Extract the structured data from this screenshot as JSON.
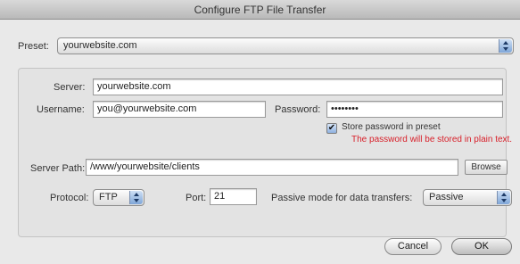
{
  "window": {
    "title": "Configure FTP File Transfer"
  },
  "preset": {
    "label": "Preset:",
    "value": "yourwebsite.com"
  },
  "server": {
    "label": "Server:",
    "value": "yourwebsite.com"
  },
  "username": {
    "label": "Username:",
    "value": "you@yourwebsite.com"
  },
  "password": {
    "label": "Password:",
    "value": "••••••••",
    "store_label": "Store password in preset",
    "store_checked": true,
    "warning": "The password will be stored in plain text."
  },
  "server_path": {
    "label": "Server Path:",
    "value": "/www/yourwebsite/clients",
    "browse_label": "Browse"
  },
  "protocol": {
    "label": "Protocol:",
    "value": "FTP"
  },
  "port": {
    "label": "Port:",
    "value": "21"
  },
  "passive": {
    "label": "Passive mode for data transfers:",
    "value": "Passive"
  },
  "buttons": {
    "cancel": "Cancel",
    "ok": "OK"
  },
  "icons": {
    "checkbox": "checkmark-icon",
    "popup": "stepper-arrows-icon"
  },
  "colors": {
    "warning": "#d8202a",
    "accent": "#7fa6d8"
  }
}
